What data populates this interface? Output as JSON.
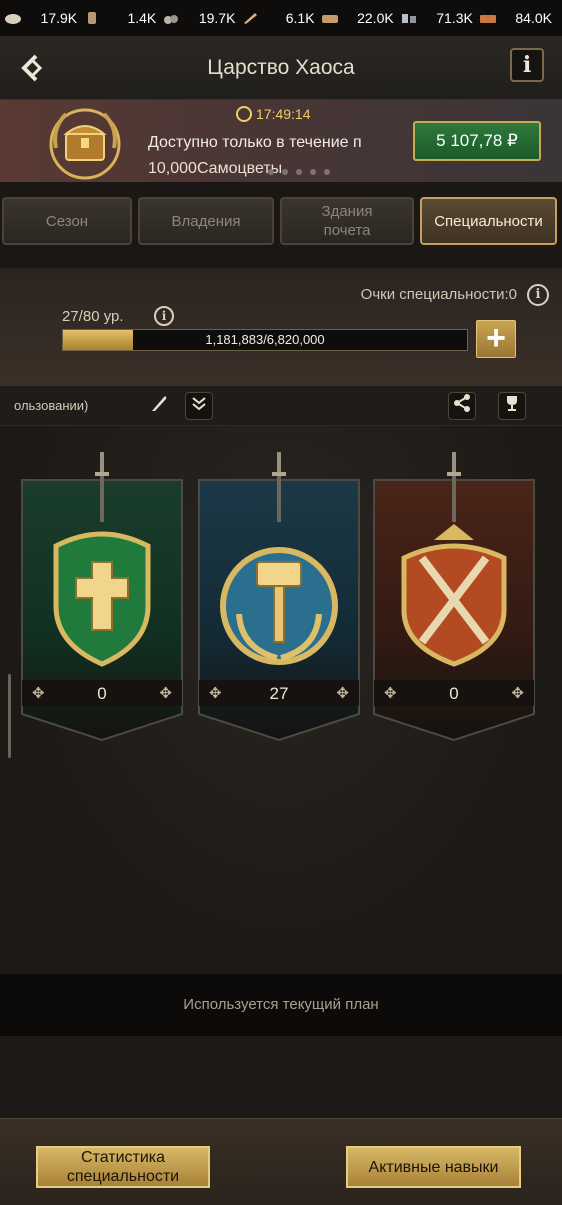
{
  "resources": [
    {
      "icon": "food-icon",
      "value": "17.9K"
    },
    {
      "icon": "wood-icon",
      "value": "1.4K"
    },
    {
      "icon": "stone-icon",
      "value": "19.7K"
    },
    {
      "icon": "iron-icon",
      "value": "6.1K"
    },
    {
      "icon": "gold-icon",
      "value": "22.0K"
    },
    {
      "icon": "silver-icon",
      "value": "71.3K"
    },
    {
      "icon": "copper-icon",
      "value": "84.0K"
    }
  ],
  "header": {
    "back_icon": "back-arrow-icon",
    "title": "Царство Хаоса",
    "info_label": "i"
  },
  "offer": {
    "timer": "17:49:14",
    "line1": "Доступно только в течение п",
    "line2": "10,000Самоцветы",
    "price": "5 107,78 ₽"
  },
  "tabs": [
    {
      "label": "Сезон",
      "active": false
    },
    {
      "label": "Владения",
      "active": false
    },
    {
      "label": "Здания почета",
      "active": false
    },
    {
      "label": "Специальности",
      "active": true
    }
  ],
  "specialty": {
    "points_label": "Очки специальности:0",
    "level_label": "27/80 ур.",
    "progress_text": "1,181,883/6,820,000",
    "progress_fraction": 0.173,
    "plus_label": "+"
  },
  "toolbar": {
    "plan_name": "ользовании)"
  },
  "branches": [
    {
      "count": "0",
      "emblem": "green-shield-cross-emblem-icon"
    },
    {
      "count": "27",
      "emblem": "blue-hammer-laurel-emblem-icon"
    },
    {
      "count": "0",
      "emblem": "red-crossed-swords-shield-emblem-icon"
    }
  ],
  "plan_status": "Используется текущий план",
  "buttons": {
    "stats": "Статистика специальности",
    "active_skills": "Активные навыки"
  },
  "colors": {
    "accent_gold": "#c8aa55",
    "price_green": "#2e7a3c",
    "timer_yellow": "#f1cf62"
  }
}
